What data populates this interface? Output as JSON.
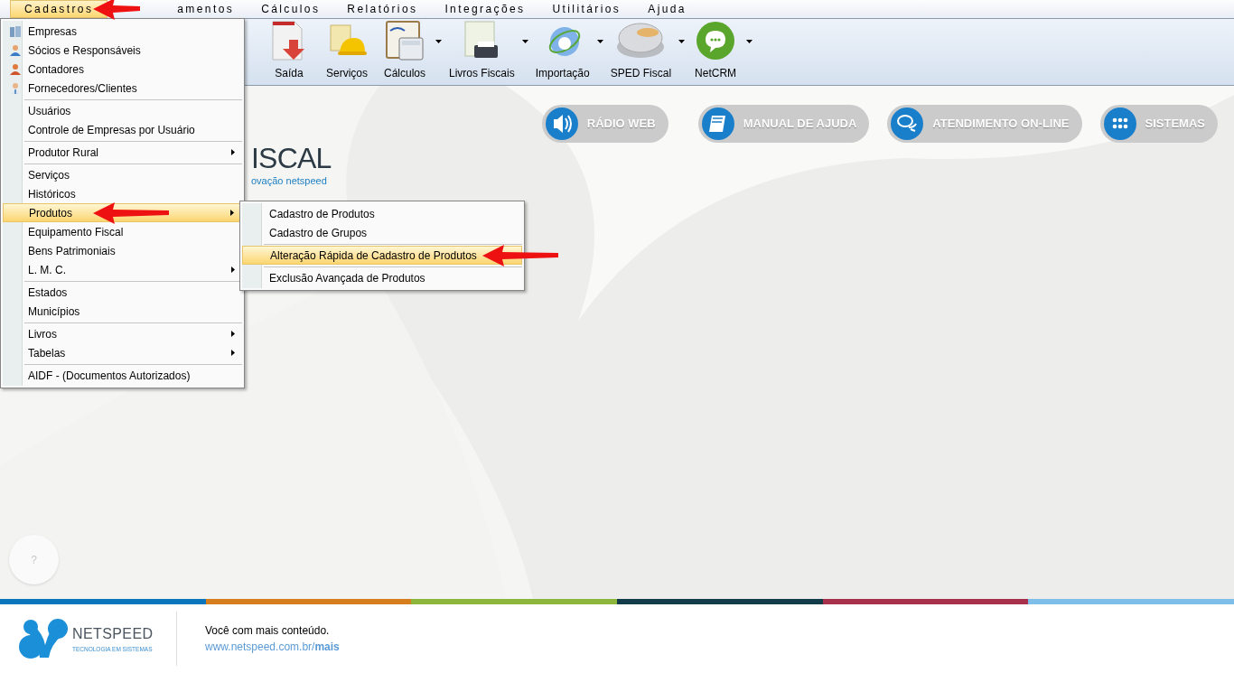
{
  "menu_bar": [
    {
      "label": "Cadastros",
      "selected": true
    },
    {
      "label": "amentos",
      "selected": false
    },
    {
      "label": "Cálculos",
      "selected": false
    },
    {
      "label": "Relatórios",
      "selected": false
    },
    {
      "label": "Integrações",
      "selected": false
    },
    {
      "label": "Utilitários",
      "selected": false
    },
    {
      "label": "Ajuda",
      "selected": false
    }
  ],
  "toolbar": [
    {
      "label": "Saída",
      "dropdown": false
    },
    {
      "label": "Serviços",
      "dropdown": false
    },
    {
      "label": "Cálculos",
      "dropdown": true
    },
    {
      "label": "Livros Fiscais",
      "dropdown": true
    },
    {
      "label": "Importação",
      "dropdown": true
    },
    {
      "label": "SPED Fiscal",
      "dropdown": true
    },
    {
      "label": "NetCRM",
      "dropdown": true
    }
  ],
  "cadastros_menu": [
    [
      {
        "label": "Empresas",
        "submenu": false,
        "selected": false
      },
      {
        "label": "Sócios e Responsáveis",
        "submenu": false,
        "selected": false
      },
      {
        "label": "Contadores",
        "submenu": false,
        "selected": false
      },
      {
        "label": "Fornecedores/Clientes",
        "submenu": false,
        "selected": false
      }
    ],
    [
      {
        "label": "Usuários",
        "submenu": false,
        "selected": false
      },
      {
        "label": "Controle de Empresas por Usuário",
        "submenu": false,
        "selected": false
      }
    ],
    [
      {
        "label": "Produtor Rural",
        "submenu": true,
        "selected": false
      }
    ],
    [
      {
        "label": "Serviços",
        "submenu": false,
        "selected": false
      },
      {
        "label": "Históricos",
        "submenu": false,
        "selected": false
      },
      {
        "label": "Produtos",
        "submenu": true,
        "selected": true
      },
      {
        "label": "Equipamento Fiscal",
        "submenu": false,
        "selected": false
      },
      {
        "label": "Bens Patrimoniais",
        "submenu": false,
        "selected": false
      },
      {
        "label": "L. M. C.",
        "submenu": true,
        "selected": false
      }
    ],
    [
      {
        "label": "Estados",
        "submenu": false,
        "selected": false
      },
      {
        "label": "Municípios",
        "submenu": false,
        "selected": false
      }
    ],
    [
      {
        "label": "Livros",
        "submenu": true,
        "selected": false
      },
      {
        "label": "Tabelas",
        "submenu": true,
        "selected": false
      }
    ],
    [
      {
        "label": "AIDF - (Documentos Autorizados)",
        "submenu": false,
        "selected": false
      }
    ]
  ],
  "produtos_submenu": [
    [
      {
        "label": "Cadastro de Produtos",
        "selected": false
      },
      {
        "label": "Cadastro de Grupos",
        "selected": false
      }
    ],
    [
      {
        "label": "Alteração Rápida de Cadastro de Produtos",
        "selected": true
      }
    ],
    [
      {
        "label": "Exclusão Avançada de Produtos",
        "selected": false
      }
    ]
  ],
  "logo": {
    "title": "ISCAL",
    "subtitle": "ovação netspeed"
  },
  "quick_buttons": [
    "RÁDIO WEB",
    "MANUAL DE AJUDA",
    "ATENDIMENTO ON-LINE",
    "SISTEMAS"
  ],
  "help_button": "?",
  "footer": {
    "brand": "NETSPEED",
    "tagline": "TECNOLOGIA EM SISTEMAS",
    "message": "Você com mais conteúdo.",
    "link": "www.netspeed.com.br/**mais**",
    "stripes": [
      {
        "color": "#0a77bd"
      },
      {
        "color": "#d67d1e"
      },
      {
        "color": "#8db63c"
      },
      {
        "color": "#133c4a"
      },
      {
        "color": "#a8304a"
      },
      {
        "color": "#7dbfe9"
      }
    ]
  }
}
